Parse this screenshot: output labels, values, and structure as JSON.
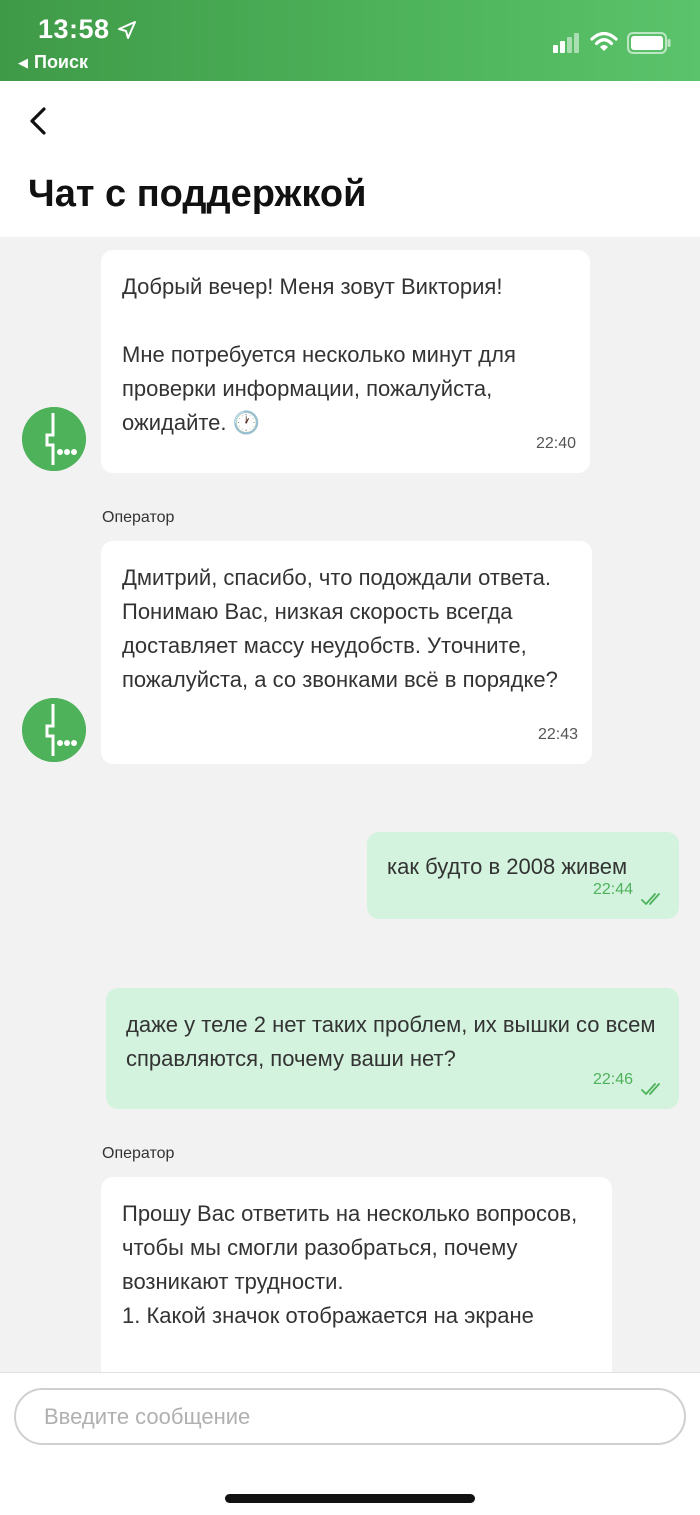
{
  "status_bar": {
    "time": "13:58",
    "back_app": "Поиск",
    "icons": [
      "location-arrow-icon",
      "signal-icon",
      "wifi-icon",
      "battery-icon"
    ]
  },
  "header": {
    "title": "Чат с поддержкой",
    "back_icon": "chevron-left-icon"
  },
  "messages": [
    {
      "from": "operator",
      "sender": "",
      "text": "Добрый вечер! Меня зовут Виктория!\n\nМне потребуется несколько минут для проверки информации, пожалуйста, ожидайте. 🕐",
      "time": "22:40"
    },
    {
      "from": "operator",
      "sender": "Оператор",
      "text": "Дмитрий, спасибо, что подождали ответа. Понимаю Вас, низкая скорость всегда доставляет массу неудобств. Уточните, пожалуйста, а со звонками всё в порядке?",
      "time": "22:43"
    },
    {
      "from": "user",
      "text": "как будто в 2008 живем",
      "time": "22:44",
      "status": "read"
    },
    {
      "from": "user",
      "text": "даже у теле 2 нет таких проблем, их вышки со всем справляются, почему ваши нет?",
      "time": "22:46",
      "status": "read"
    },
    {
      "from": "operator",
      "sender": "Оператор",
      "text": "Прошу Вас ответить на несколько вопросов, чтобы мы смогли разобраться, почему возникают трудности.\n1. Какой значок отображается на экране",
      "time": ""
    }
  ],
  "composer": {
    "placeholder": "Введите сообщение"
  },
  "colors": {
    "brand_green": "#4db25a",
    "user_bubble": "#d3f3de",
    "chat_background": "#f2f2f2"
  }
}
